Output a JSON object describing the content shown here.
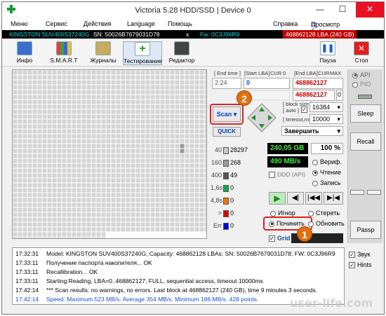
{
  "window": {
    "title": "Victoria 5.28 HDD/SSD | Device 0",
    "minimize": "—",
    "maximize": "☐",
    "close": "✕"
  },
  "menu": [
    "Меню",
    "Сервис",
    "Действия",
    "Language",
    "Помощь",
    "Справка",
    "Просмотр буфера"
  ],
  "device": {
    "model": "KINGSTON SUV400S37240G",
    "sn": "SN: 50026B7679031D78",
    "close": "x",
    "fw": "Fw: 0C3J96R9",
    "lba": "468862128 LBA (240 GB)"
  },
  "toolbar": {
    "info": "Инфо",
    "smart": "S.M.A.R.T",
    "journals": "Журналы",
    "testing": "Тестирование",
    "editor": "Редактор",
    "pause": "Пауза",
    "stop": "Стоп"
  },
  "scan_panel": {
    "end_time_label": "[ End time ]",
    "start_lba_label": "[Start LBA]",
    "cur_label": "CUR",
    "zero_label": "0",
    "end_lba_label": "[End LBA]",
    "max_label": "MAX",
    "end_time": "2:24",
    "start_lba": "0",
    "end_lba": "468862127",
    "end_lba2": "468862127",
    "second_val": "0",
    "block_size_label": "[ block size ]",
    "auto_label": "[ auto ]",
    "timeout_label": "[ timeout,ms ]",
    "block_size": "16384",
    "timeout": "10000",
    "scan_button": "Scan",
    "quick_button": "QUICK",
    "finish": "Завершить"
  },
  "counters": [
    {
      "label": "40",
      "value": "28297",
      "color": "#c8c8c8"
    },
    {
      "label": "160",
      "value": "268",
      "color": "#9a9a9a"
    },
    {
      "label": "400",
      "value": "49",
      "color": "#555555"
    },
    {
      "label": "1,6s",
      "value": "0",
      "color": "#00b050"
    },
    {
      "label": "4,8s",
      "value": "0",
      "color": "#f07800"
    },
    {
      "label": ">",
      "value": "0",
      "color": "#e00000"
    },
    {
      "label": "Err",
      "value": "0",
      "color": "#0000e0"
    }
  ],
  "stats": {
    "size": "240,05 GB",
    "percent": "100",
    "percent_unit": "%",
    "speed": "490 MB/s",
    "ddd": "DDD (API)"
  },
  "modes": {
    "verify": "Вериф.",
    "read": "Чтение",
    "write": "Запись"
  },
  "actions": {
    "ignore": "Игнор",
    "erase": "Стереть",
    "repair": "Починить",
    "refresh": "Обновить",
    "grid": "Grid"
  },
  "sidebar": {
    "api": "API",
    "pio": "PIO",
    "sleep": "Sleep",
    "recall": "Recall",
    "passp": "Passp"
  },
  "badges": {
    "one": "1",
    "two": "2"
  },
  "log": [
    {
      "time": "17:32:31",
      "text": "Model: KINGSTON SUV400S37240G; Capacity: 468862128 LBAs; SN: 50026B7679031D78; FW: 0C3J96R9",
      "color": "#000000"
    },
    {
      "time": "17:33:11",
      "text": "Получение паспорта накопителя... OK",
      "color": "#000000"
    },
    {
      "time": "17:33:11",
      "text": "Recallibration... OK",
      "color": "#000000"
    },
    {
      "time": "17:33:11",
      "text": "Starting Reading, LBA=0..468862127, FULL, sequential access, timeout 10000ms",
      "color": "#000000"
    },
    {
      "time": "17:42:14",
      "text": "*** Scan results: no warnings, no errors. Last block at 468862127 (240 GB), time 9 minutes 3 seconds.",
      "color": "#000000"
    },
    {
      "time": "17:42:14",
      "text": "Speed: Maximum 523 MB/s. Average 354 MB/s. Minimum 186 MB/s. 428 points.",
      "color": "#1a4fd0"
    }
  ],
  "log_options": {
    "sound": "Звук",
    "hints": "Hints"
  },
  "watermark": "user-life.com"
}
